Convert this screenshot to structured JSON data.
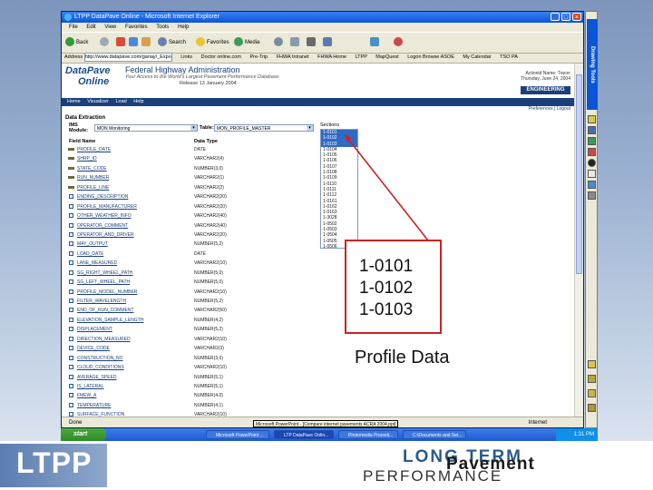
{
  "window": {
    "title": "LTPP DataPave Online - Microsoft Internet Explorer",
    "menu": [
      "File",
      "Edit",
      "View",
      "Favorites",
      "Tools",
      "Help"
    ],
    "toolbar": [
      "Back",
      "Search",
      "Favorites",
      "Media"
    ],
    "address_label": "Address",
    "address": "http://www.datapave.com/ganay/_Export0.ws",
    "links": [
      "Links",
      "Doctor online.com",
      "Pre-Trip",
      "FHWA Intranet",
      "FHWA Home",
      "LTPP",
      "MapQuest",
      "Logon Browse ASOE",
      "My Calendar",
      "TSO PA"
    ]
  },
  "site": {
    "logo_line1": "DataPave",
    "logo_line2": "Online",
    "agency": "Federal Highway Administration",
    "tagline": "Your Access to the World's Largest Pavement Performance Database",
    "release": "Release 13  January 2004",
    "right_tag_1": "Actionid Name: Tracer",
    "right_tag_2": "Thursday, June 24, 2004",
    "badge": "ENGINEERING",
    "nav": [
      "Home",
      "Visualizer",
      "Load",
      "Help"
    ],
    "nav_right": "Preferences | Logout"
  },
  "extraction": {
    "heading": "Data Extraction",
    "ims_label": "IMS Module:",
    "ims_value": "MON Monitoring",
    "table_label": "Table:",
    "table_value": "MON_PROFILE_MASTER",
    "col_field": "Field Name",
    "col_type": "Data Type",
    "sections_label": "Sections",
    "sections": [
      "1-0101",
      "1-0102",
      "1-0103",
      "1-0104",
      "1-0105",
      "1-0106",
      "1-0107",
      "1-0108",
      "1-0109",
      "1-0110",
      "1-0111",
      "1-0112",
      "1-0161",
      "1-0162",
      "1-0163",
      "1-3028",
      "1-0502",
      "1-0503",
      "1-0504",
      "1-0505",
      "1-0506"
    ],
    "selected_sections": [
      0,
      1,
      2
    ],
    "fields": [
      {
        "name": "PROFILE_DATE",
        "type": "DATE",
        "key": true
      },
      {
        "name": "SHRP_ID",
        "type": "VARCHAR2(4)",
        "key": true
      },
      {
        "name": "STATE_CODE",
        "type": "NUMBER(3,0)",
        "key": true
      },
      {
        "name": "RUN_NUMBER",
        "type": "VARCHAR2(1)",
        "key": true
      },
      {
        "name": "PROFILE_LINE",
        "type": "VARCHAR2(2)",
        "key": true
      },
      {
        "name": "ENDING_DESCRIPTION",
        "type": "VARCHAR2(20)",
        "key": false
      },
      {
        "name": "PROFILE_MANUFACTURER",
        "type": "VARCHAR2(20)",
        "key": false
      },
      {
        "name": "OTHER_WEATHER_INFO",
        "type": "VARCHAR2(40)",
        "key": false
      },
      {
        "name": "OPERATOR_COMMENT",
        "type": "VARCHAR2(40)",
        "key": false
      },
      {
        "name": "OPERATOR_AND_DRIVER",
        "type": "VARCHAR2(20)",
        "key": false
      },
      {
        "name": "MAY_OUTPUT",
        "type": "NUMBER(5,2)",
        "key": false
      },
      {
        "name": "LOAD_DATE",
        "type": "DATE",
        "key": false
      },
      {
        "name": "LANE_MEASURED",
        "type": "VARCHAR2(10)",
        "key": false
      },
      {
        "name": "SG_RIGHT_WHEEL_PATH",
        "type": "NUMBER(5,0)",
        "key": false
      },
      {
        "name": "SG_LEFT_WHEEL_PATH",
        "type": "NUMBER(5,0)",
        "key": false
      },
      {
        "name": "PROFILE_MODEL_NUMBER",
        "type": "VARCHAR2(10)",
        "key": false
      },
      {
        "name": "FILTER_WAVELENGTH",
        "type": "NUMBER(5,2)",
        "key": false
      },
      {
        "name": "END_OF_RUN_COMMENT",
        "type": "VARCHAR2(50)",
        "key": false
      },
      {
        "name": "ELEVATION_SAMPLE_LENGTH",
        "type": "NUMBER(4,2)",
        "key": false
      },
      {
        "name": "DISPLACEMENT",
        "type": "NUMBER(5,2)",
        "key": false
      },
      {
        "name": "DIRECTION_MEASURED",
        "type": "VARCHAR2(10)",
        "key": false
      },
      {
        "name": "DEVICE_CODE",
        "type": "VARCHAR2(3)",
        "key": false
      },
      {
        "name": "CONSTRUCTION_NO",
        "type": "NUMBER(3,0)",
        "key": false
      },
      {
        "name": "CLOUD_CONDITIONS",
        "type": "VARCHAR2(10)",
        "key": false
      },
      {
        "name": "AVERAGE_SPEED",
        "type": "NUMBER(5,1)",
        "key": false
      },
      {
        "name": "IS_LATERAL",
        "type": "NUMBER(5,1)",
        "key": false
      },
      {
        "name": "FMEW_A",
        "type": "NUMBER(4,0)",
        "key": false
      },
      {
        "name": "TEMPERATURE",
        "type": "NUMBER(4,1)",
        "key": false
      },
      {
        "name": "SURFACE_FUNCTION",
        "type": "VARCHAR2(10)",
        "key": false
      },
      {
        "name": "SPOT_METHOD",
        "type": "VARCHAR2(10)",
        "key": false
      }
    ]
  },
  "status": {
    "left": "Done",
    "right": "Internet"
  },
  "side_toolbar_title": "Drawing Tools",
  "taskbar": {
    "start": "start",
    "tasks": [
      "Microsoft PowerPoint ...",
      "LTP DataPave Onlin...",
      "Photomedia Procedi...",
      "C:\\Documents and Set..."
    ],
    "tooltip": "Microsoft PowerPoint - [Compare internet pavements ACRA 2004.ppt]",
    "clock": "1:31 PM"
  },
  "annotation": {
    "lines": [
      "1-0101",
      "1-0102",
      "1-0103"
    ],
    "caption": "Profile Data",
    "border_color": "#cc2222"
  },
  "footer": {
    "left_logo": "LTPP",
    "right_logo_top": "LONG TERM",
    "right_logo_mid": "Pavement",
    "right_logo_bottom": "PERFORMANCE"
  }
}
